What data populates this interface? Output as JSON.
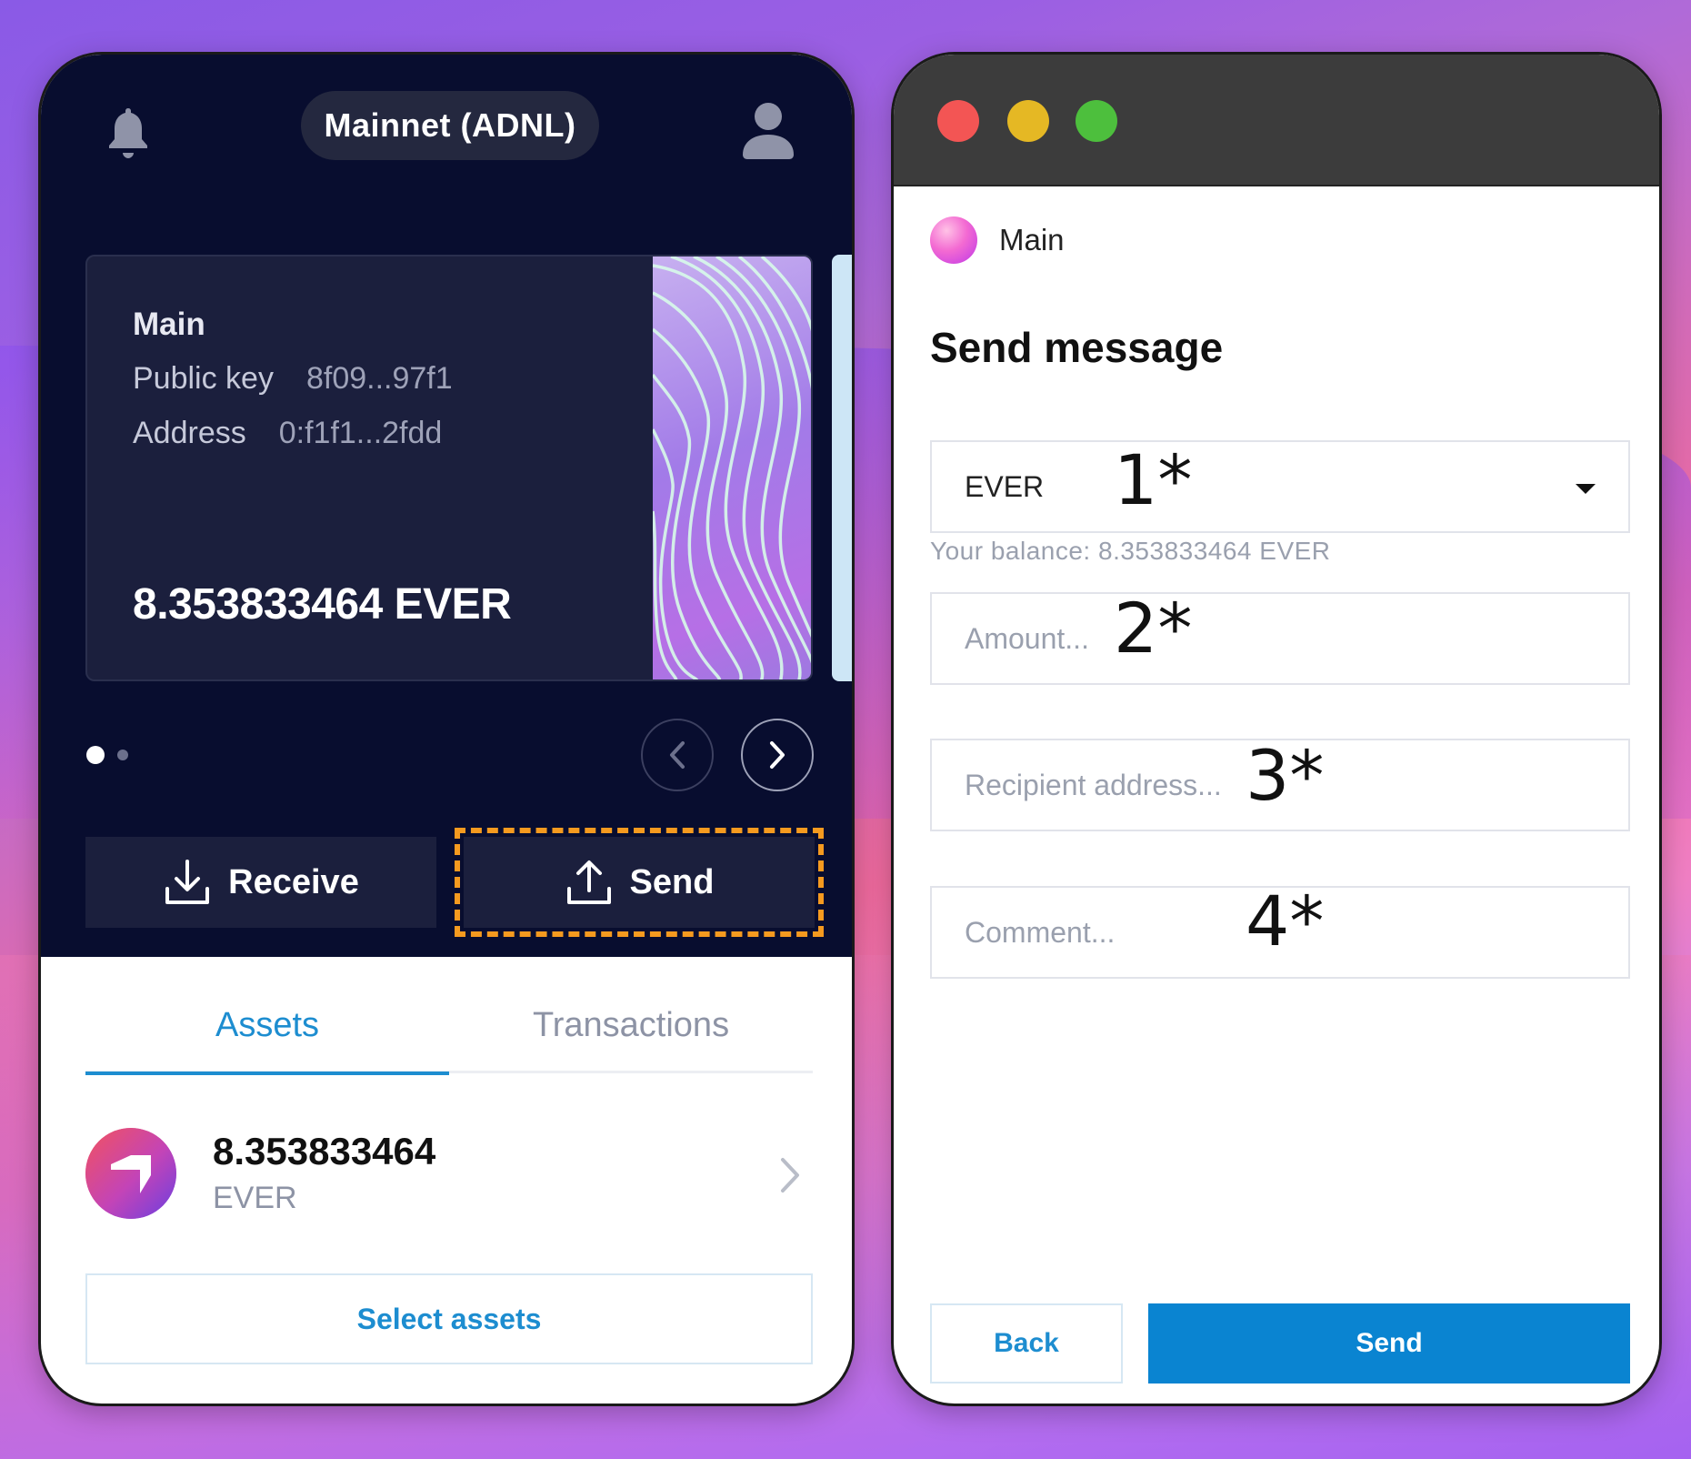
{
  "wallet": {
    "network": "Mainnet (ADNL)",
    "account": {
      "name": "Main",
      "public_key_label": "Public key",
      "public_key": "8f09...97f1",
      "address_label": "Address",
      "address": "0:f1f1...2fdd",
      "balance": "8.353833464 EVER"
    },
    "carousel": {
      "current": 1,
      "total": 2
    },
    "actions": {
      "receive": "Receive",
      "send": "Send"
    },
    "tabs": {
      "assets": "Assets",
      "transactions": "Transactions",
      "active": "Assets"
    },
    "assets": [
      {
        "amount": "8.353833464",
        "symbol": "EVER"
      }
    ],
    "select_assets": "Select assets",
    "highlight_color": "#f59a1f"
  },
  "send_window": {
    "account_name": "Main",
    "title": "Send message",
    "token": "EVER",
    "balance_hint": "Your balance: 8.353833464 EVER",
    "amount_placeholder": "Amount...",
    "recipient_placeholder": "Recipient address...",
    "comment_placeholder": "Comment...",
    "back": "Back",
    "send": "Send",
    "accent_color": "#0a84d1"
  },
  "annotations": [
    "1*",
    "2*",
    "3*",
    "4*"
  ]
}
